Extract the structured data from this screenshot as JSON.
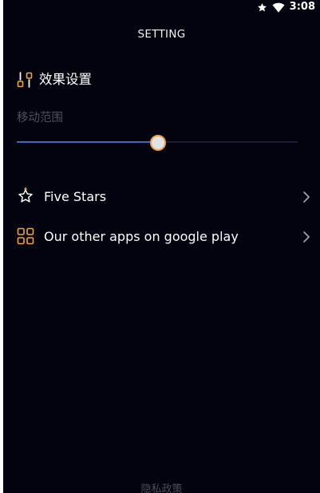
{
  "status_bar": {
    "time": "3:08",
    "icons": [
      "star-icon",
      "wifi-icon"
    ]
  },
  "header": {
    "title": "SETTING"
  },
  "effect_section": {
    "title": "效果设置",
    "icon": "sliders-icon",
    "slider": {
      "label": "移动范围",
      "value_fraction": 0.5
    }
  },
  "menu": {
    "items": [
      {
        "label": "Five Stars",
        "icon": "star-outline-icon"
      },
      {
        "label": "Our other apps on google play",
        "icon": "apps-grid-icon"
      }
    ]
  },
  "footer": {
    "privacy_label": "隐私政策"
  },
  "colors": {
    "background": "#02030f",
    "accent_orange": "#f2a43a",
    "slider_fill": "#3a67cc",
    "slider_track": "#1a1d33",
    "muted_text": "#4e505c"
  }
}
